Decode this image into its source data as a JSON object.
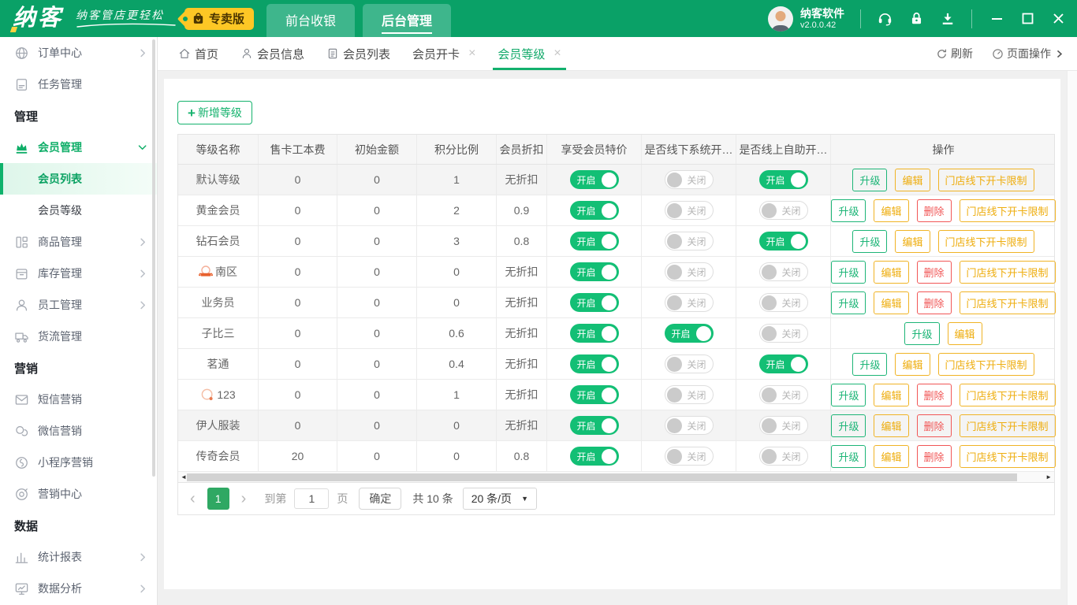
{
  "colors": {
    "primary_green": "#0aa167",
    "toggle_on_green": "#13bf75",
    "amber": "#f0b325",
    "red": "#f15656",
    "badge_yellow": "#fdc725",
    "page_green": "#2fa863"
  },
  "header": {
    "logo": "纳客",
    "slogan": "纳客管店更轻松",
    "badge_label": "专卖版",
    "nav_tabs": [
      {
        "label": "前台收银",
        "active": false
      },
      {
        "label": "后台管理",
        "active": true
      }
    ],
    "user": {
      "name": "纳客软件",
      "version": "v2.0.0.42"
    },
    "icons": [
      "headset-icon",
      "lock-icon",
      "download-icon",
      "minimize-icon",
      "maximize-icon",
      "close-icon"
    ]
  },
  "tabbar": {
    "tabs": [
      {
        "label": "首页",
        "icon": "home-icon",
        "closable": false,
        "active": false
      },
      {
        "label": "会员信息",
        "icon": "user-icon",
        "closable": false,
        "active": false
      },
      {
        "label": "会员列表",
        "icon": "doc-icon",
        "closable": false,
        "active": false
      },
      {
        "label": "会员开卡",
        "icon": null,
        "closable": true,
        "active": false
      },
      {
        "label": "会员等级",
        "icon": null,
        "closable": true,
        "active": true
      }
    ],
    "refresh_label": "刷新",
    "page_ops_label": "页面操作"
  },
  "sidebar": {
    "items": [
      {
        "type": "item",
        "label": "订单中心",
        "icon": "globe-icon",
        "expandable": true
      },
      {
        "type": "item",
        "label": "任务管理",
        "icon": "task-icon",
        "expandable": false
      },
      {
        "type": "section",
        "label": "管理"
      },
      {
        "type": "item",
        "label": "会员管理",
        "icon": "crown-icon",
        "expandable": true,
        "expanded": true,
        "active": true
      },
      {
        "type": "subitem",
        "label": "会员列表",
        "active": true
      },
      {
        "type": "subitem",
        "label": "会员等级",
        "active": false
      },
      {
        "type": "item",
        "label": "商品管理",
        "icon": "goods-icon",
        "expandable": true
      },
      {
        "type": "item",
        "label": "库存管理",
        "icon": "inventory-icon",
        "expandable": true
      },
      {
        "type": "item",
        "label": "员工管理",
        "icon": "staff-icon",
        "expandable": true
      },
      {
        "type": "item",
        "label": "货流管理",
        "icon": "truck-icon",
        "expandable": false
      },
      {
        "type": "section",
        "label": "营销"
      },
      {
        "type": "item",
        "label": "短信营销",
        "icon": "mail-icon",
        "expandable": false
      },
      {
        "type": "item",
        "label": "微信营销",
        "icon": "wechat-icon",
        "expandable": false
      },
      {
        "type": "item",
        "label": "小程序营销",
        "icon": "miniapp-icon",
        "expandable": false
      },
      {
        "type": "item",
        "label": "营销中心",
        "icon": "target-icon",
        "expandable": false
      },
      {
        "type": "section",
        "label": "数据"
      },
      {
        "type": "item",
        "label": "统计报表",
        "icon": "chart-icon",
        "expandable": true
      },
      {
        "type": "item",
        "label": "数据分析",
        "icon": "monitor-icon",
        "expandable": true
      }
    ]
  },
  "main": {
    "add_button_label": "新增等级",
    "table": {
      "columns": [
        "等级名称",
        "售卡工本费",
        "初始金额",
        "积分比例",
        "会员折扣",
        "享受会员特价",
        "是否线下系统开…",
        "是否线上自助开…",
        "操作"
      ],
      "toggle_on_label": "开启",
      "toggle_off_label": "关闭",
      "op_labels": {
        "upgrade": "升级",
        "edit": "编辑",
        "delete": "删除",
        "limit": "门店线下开卡限制"
      },
      "rows": [
        {
          "name": "默认等级",
          "icon": null,
          "fee": "0",
          "initial": "0",
          "ratio": "1",
          "discount": "无折扣",
          "special": "on",
          "offline": "off",
          "online": "on",
          "ops": [
            "upgrade",
            "edit",
            "limit"
          ],
          "shaded": true
        },
        {
          "name": "黄金会员",
          "icon": null,
          "fee": "0",
          "initial": "0",
          "ratio": "2",
          "discount": "0.9",
          "special": "on",
          "offline": "off",
          "online": "off",
          "ops": [
            "upgrade",
            "edit",
            "delete",
            "limit"
          ],
          "shaded": false
        },
        {
          "name": "钻石会员",
          "icon": null,
          "fee": "0",
          "initial": "0",
          "ratio": "3",
          "discount": "0.8",
          "special": "on",
          "offline": "off",
          "online": "on",
          "ops": [
            "upgrade",
            "edit",
            "limit"
          ],
          "shaded": false
        },
        {
          "name": "南区",
          "icon": "medal-icon",
          "fee": "0",
          "initial": "0",
          "ratio": "0",
          "discount": "无折扣",
          "special": "on",
          "offline": "off",
          "online": "off",
          "ops": [
            "upgrade",
            "edit",
            "delete",
            "limit"
          ],
          "shaded": false
        },
        {
          "name": "业务员",
          "icon": null,
          "fee": "0",
          "initial": "0",
          "ratio": "0",
          "discount": "无折扣",
          "special": "on",
          "offline": "off",
          "online": "off",
          "ops": [
            "upgrade",
            "edit",
            "delete",
            "limit"
          ],
          "shaded": false
        },
        {
          "name": "子比三",
          "icon": null,
          "fee": "0",
          "initial": "0",
          "ratio": "0.6",
          "discount": "无折扣",
          "special": "on",
          "offline": "on",
          "online": "off",
          "ops": [
            "upgrade",
            "edit"
          ],
          "shaded": false
        },
        {
          "name": "茗通",
          "icon": null,
          "fee": "0",
          "initial": "0",
          "ratio": "0.4",
          "discount": "无折扣",
          "special": "on",
          "offline": "off",
          "online": "on",
          "ops": [
            "upgrade",
            "edit",
            "limit"
          ],
          "shaded": false
        },
        {
          "name": "123",
          "icon": "ring-icon",
          "fee": "0",
          "initial": "0",
          "ratio": "1",
          "discount": "无折扣",
          "special": "on",
          "offline": "off",
          "online": "off",
          "ops": [
            "upgrade",
            "edit",
            "delete",
            "limit"
          ],
          "shaded": false
        },
        {
          "name": "伊人服装",
          "icon": null,
          "fee": "0",
          "initial": "0",
          "ratio": "0",
          "discount": "无折扣",
          "special": "on",
          "offline": "off",
          "online": "off",
          "ops": [
            "upgrade",
            "edit",
            "delete",
            "limit"
          ],
          "shaded": true
        },
        {
          "name": "传奇会员",
          "icon": null,
          "fee": "20",
          "initial": "0",
          "ratio": "0",
          "discount": "0.8",
          "special": "on",
          "offline": "off",
          "online": "off",
          "ops": [
            "upgrade",
            "edit",
            "delete",
            "limit"
          ],
          "shaded": false
        }
      ]
    },
    "pagination": {
      "prev": "‹",
      "current": "1",
      "next": "›",
      "goto_label": "到第",
      "goto_value": "1",
      "page_label": "页",
      "confirm_label": "确定",
      "total_label": "共 10 条",
      "size_label": "20 条/页"
    }
  }
}
